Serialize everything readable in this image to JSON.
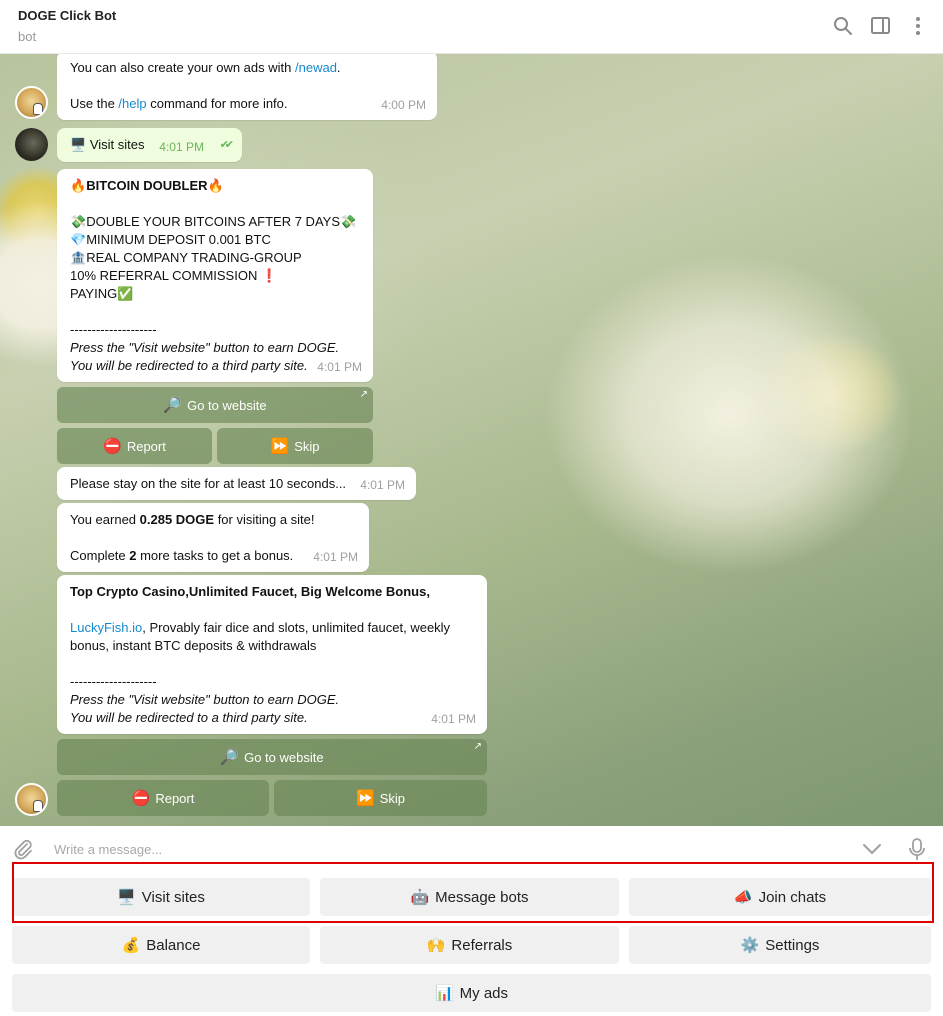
{
  "header": {
    "title": "DOGE Click Bot",
    "subtitle": "bot"
  },
  "messages": {
    "m1": {
      "line1_prefix": "You can also create your own ads with ",
      "line1_link": "/newad",
      "line1_suffix": ".",
      "line2_prefix": "Use the ",
      "line2_link": "/help",
      "line2_suffix": " command for more info.",
      "time": "4:00 PM"
    },
    "m2": {
      "emoji": "🖥️",
      "text": "Visit sites",
      "time": "4:01 PM",
      "status": "✔✔"
    },
    "m3": {
      "title_emoji": "🔥",
      "title": "BITCOIN DOUBLER",
      "l1_emoji": "💸",
      "l1": "DOUBLE YOUR BITCOINS AFTER 7 DAYS",
      "l2_emoji": "💎",
      "l2": "MINIMUM DEPOSIT 0.001 BTC",
      "l3_emoji": "🏦",
      "l3": "REAL COMPANY TRADING-GROUP",
      "l4": "10% REFERRAL COMMISSION ",
      "l4_emoji": "❗",
      "l5": "PAYING",
      "l5_emoji": "✅",
      "divider": "--------------------",
      "note1": "Press the \"Visit website\" button to earn DOGE.",
      "note2": "You will be redirected to a third party site.",
      "time": "4:01 PM"
    },
    "m3_buttons": {
      "go_emoji": "🔎",
      "go": "Go to website",
      "report_emoji": "⛔",
      "report": "Report",
      "skip_emoji": "⏩",
      "skip": "Skip",
      "arrow": "↗"
    },
    "m4": {
      "text": "Please stay on the site for at least 10 seconds...",
      "time": "4:01 PM"
    },
    "m5": {
      "prefix": "You earned ",
      "amount": "0.285 DOGE",
      "suffix": " for visiting a site!",
      "l2_prefix": "Complete ",
      "l2_count": "2",
      "l2_suffix": " more tasks to get a bonus.",
      "time": "4:01 PM"
    },
    "m6": {
      "title": "Top Crypto Casino,Unlimited Faucet, Big Welcome Bonus,",
      "link": "LuckyFish.io",
      "desc1": ", Provably fair dice and slots, unlimited faucet, weekly",
      "desc2": "bonus, instant BTC deposits & withdrawals",
      "divider": "--------------------",
      "note1": "Press the \"Visit website\" button to earn DOGE.",
      "note2": "You will be redirected to a third party site.",
      "time": "4:01 PM"
    },
    "m6_buttons": {
      "go_emoji": "🔎",
      "go": "Go to website",
      "report_emoji": "⛔",
      "report": "Report",
      "skip_emoji": "⏩",
      "skip": "Skip",
      "arrow": "↗"
    }
  },
  "composer": {
    "placeholder": "Write a message..."
  },
  "keyboard": {
    "visit_emoji": "🖥️",
    "visit": "Visit sites",
    "bots_emoji": "🤖",
    "bots": "Message bots",
    "join_emoji": "📣",
    "join": "Join chats",
    "balance_emoji": "💰",
    "balance": "Balance",
    "referrals_emoji": "🙌",
    "referrals": "Referrals",
    "settings_emoji": "⚙️",
    "settings": "Settings",
    "ads_emoji": "📊",
    "ads": "My ads"
  },
  "colors": {
    "highlight": "#e00000",
    "link": "#168acd",
    "inline_button": "#6a8454"
  },
  "icons": [
    "search-icon",
    "sidebar-toggle-icon",
    "more-vert-icon",
    "attach-icon",
    "chevron-down-icon",
    "mic-icon"
  ]
}
